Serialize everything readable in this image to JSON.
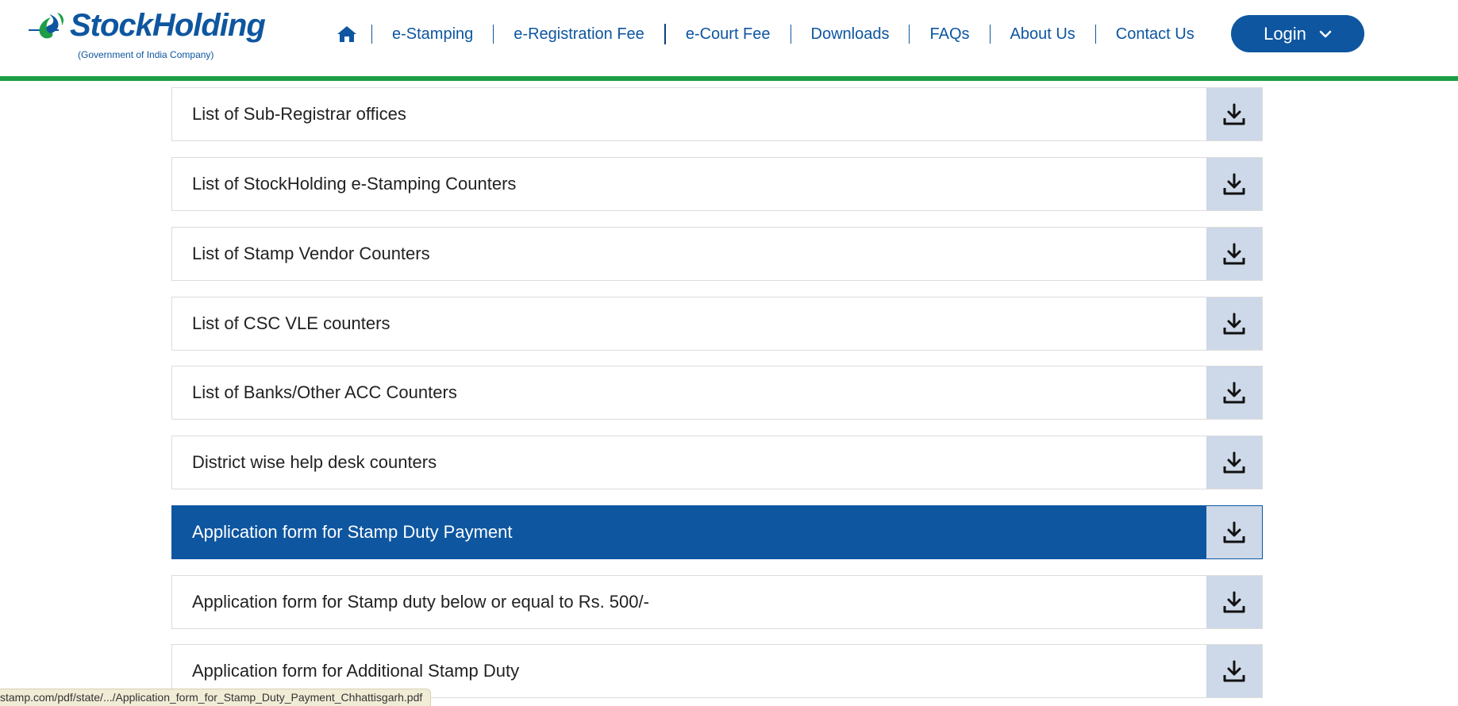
{
  "header": {
    "brand": "StockHolding",
    "tagline": "(Government of India Company)",
    "home_icon": "home-icon",
    "nav": [
      {
        "label": "e-Stamping"
      },
      {
        "label": "e-Registration Fee"
      },
      {
        "label": "e-Court Fee"
      },
      {
        "label": "Downloads"
      },
      {
        "label": "FAQs"
      },
      {
        "label": "About Us"
      },
      {
        "label": "Contact Us"
      }
    ],
    "login_label": "Login",
    "login_icon": "chevron-down-icon"
  },
  "downloads": {
    "download_icon": "download-icon",
    "items": [
      {
        "label": "List of Sub-Registrar offices",
        "active": false
      },
      {
        "label": "List of StockHolding e-Stamping Counters",
        "active": false
      },
      {
        "label": "List of Stamp Vendor Counters",
        "active": false
      },
      {
        "label": "List of CSC VLE counters",
        "active": false
      },
      {
        "label": "List of Banks/Other ACC Counters",
        "active": false
      },
      {
        "label": "District wise help desk counters",
        "active": false
      },
      {
        "label": "Application form for Stamp Duty Payment",
        "active": true
      },
      {
        "label": "Application form for Stamp duty below or equal to Rs. 500/-",
        "active": false
      },
      {
        "label": "Application form for Additional Stamp Duty",
        "active": false
      }
    ]
  },
  "statusbar": {
    "url": "stamp.com/pdf/state/.../Application_form_for_Stamp_Duty_Payment_Chhattisgarh.pdf"
  },
  "colors": {
    "brand_blue": "#0e56a0",
    "accent_green": "#1e9e46",
    "download_bg": "#cdd8e8"
  }
}
